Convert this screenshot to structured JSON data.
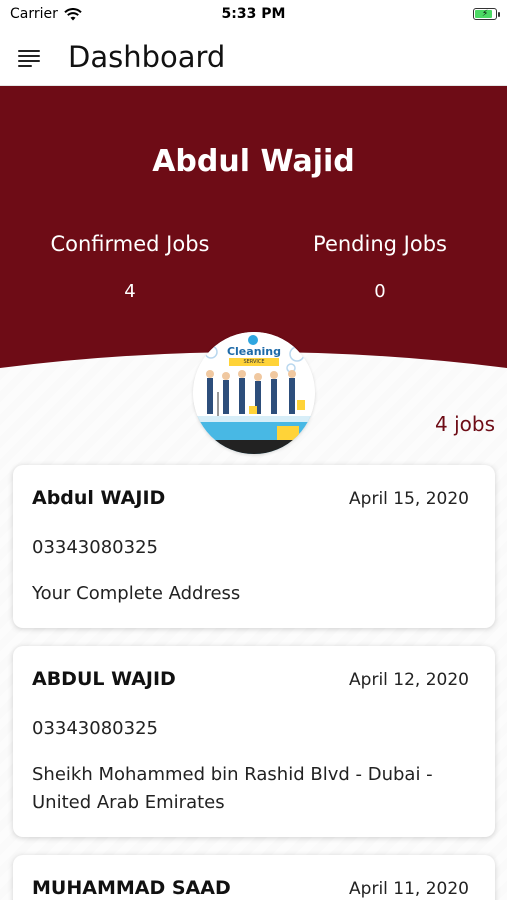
{
  "status_bar": {
    "carrier": "Carrier",
    "time": "5:33 PM"
  },
  "header": {
    "title": "Dashboard"
  },
  "profile": {
    "name": "Abdul Wajid",
    "confirmed_label": "Confirmed Jobs",
    "confirmed_value": "4",
    "pending_label": "Pending Jobs",
    "pending_value": "0"
  },
  "logo": {
    "title": "Cleaning",
    "subtitle": "SERVICE"
  },
  "jobs_count": "4 jobs",
  "jobs": [
    {
      "name": "Abdul WAJID",
      "date": "April 15, 2020",
      "phone": "03343080325",
      "address": "Your Complete Address"
    },
    {
      "name": "ABDUL WAJID",
      "date": "April 12, 2020",
      "phone": "03343080325",
      "address": "Sheikh Mohammed bin Rashid Blvd - Dubai - United Arab Emirates"
    },
    {
      "name": "MUHAMMAD SAAD",
      "date": "April 11, 2020"
    }
  ],
  "colors": {
    "brand": "#6e0c16",
    "battery": "#4cd964"
  }
}
